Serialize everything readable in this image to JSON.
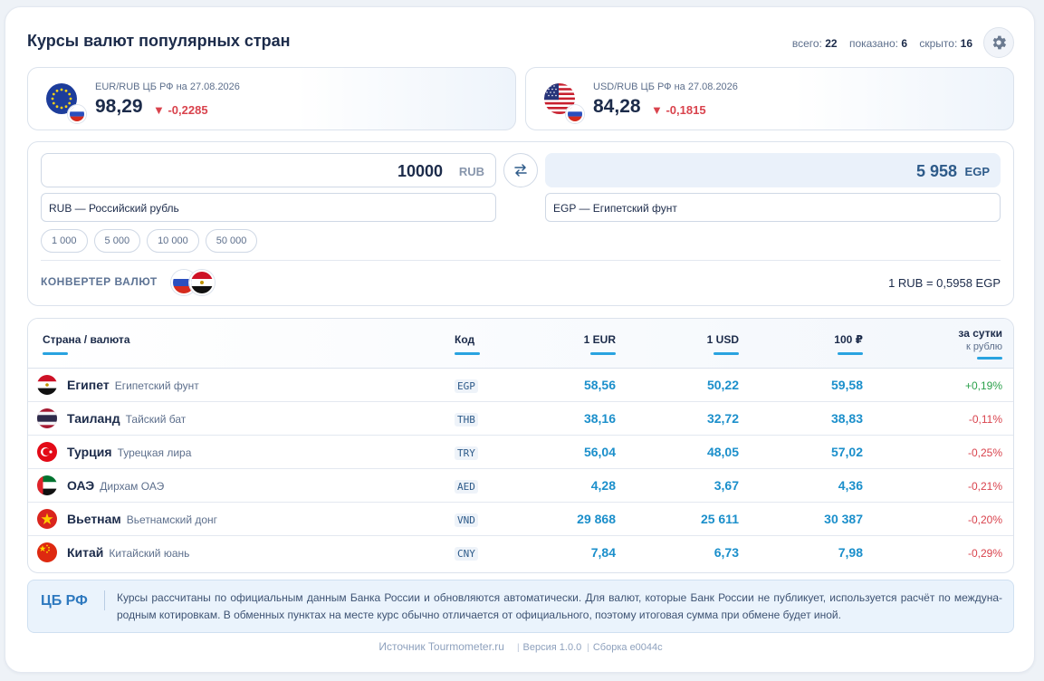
{
  "header": {
    "title": "Курсы валют популярных стран",
    "stats": [
      {
        "label": "всего:",
        "value": "22"
      },
      {
        "label": "показано:",
        "value": "6"
      },
      {
        "label": "скрыто:",
        "value": "16"
      }
    ],
    "settings_icon": "gear-icon"
  },
  "rates": {
    "eur": {
      "label": "EUR/RUB ЦБ РФ на 27.08.2026",
      "value": "98,29",
      "change": "▼ -0,2285"
    },
    "usd": {
      "label": "USD/RUB ЦБ РФ на 27.08.2026",
      "value": "84,28",
      "change": "▼ -0,1815"
    }
  },
  "converter": {
    "amount": "10000",
    "from_code": "RUB",
    "result": "5 958",
    "to_code": "EGP",
    "from_select": "RUB — Российский рубль",
    "to_select": "EGP — Египетский фунт",
    "quick_amounts": [
      "1 000",
      "5 000",
      "10 000",
      "50 000"
    ],
    "label": "КОНВЕРТЕР ВАЛЮТ",
    "rate_line": "1 RUB = 0,5958 EGP",
    "swap_icon": "swap-arrows-icon"
  },
  "table": {
    "headers": {
      "country": "Страна / валюта",
      "code": "Код",
      "eur": "1 EUR",
      "usd": "1 USD",
      "rub": "100 ₽",
      "day": "за сутки",
      "day_sub": "к рублю"
    },
    "rows": [
      {
        "country": "Египет",
        "currency": "Египетский фунт",
        "code": "EGP",
        "eur": "58,56",
        "usd": "50,22",
        "rub": "59,58",
        "change": "+0,19%",
        "dir": "up"
      },
      {
        "country": "Таиланд",
        "currency": "Тайский бат",
        "code": "THB",
        "eur": "38,16",
        "usd": "32,72",
        "rub": "38,83",
        "change": "-0,11%",
        "dir": "down"
      },
      {
        "country": "Турция",
        "currency": "Турецкая лира",
        "code": "TRY",
        "eur": "56,04",
        "usd": "48,05",
        "rub": "57,02",
        "change": "-0,25%",
        "dir": "down"
      },
      {
        "country": "ОАЭ",
        "currency": "Дирхам ОАЭ",
        "code": "AED",
        "eur": "4,28",
        "usd": "3,67",
        "rub": "4,36",
        "change": "-0,21%",
        "dir": "down"
      },
      {
        "country": "Вьетнам",
        "currency": "Вьетнамский донг",
        "code": "VND",
        "eur": "29 868",
        "usd": "25 611",
        "rub": "30 387",
        "change": "-0,20%",
        "dir": "down"
      },
      {
        "country": "Китай",
        "currency": "Китайский юань",
        "code": "CNY",
        "eur": "7,84",
        "usd": "6,73",
        "rub": "7,98",
        "change": "-0,29%",
        "dir": "down"
      }
    ]
  },
  "note": {
    "badge": "ЦБ РФ",
    "text": "Курсы рассчитаны по официальным данным Банка России и обновляются автоматически. Для валют, которые Банк России не публикует, используется расчёт по междуна-родным котировкам. В обменных пунктах на месте курс обычно отличается от официального, поэтому итоговая сумма при обмене будет иной."
  },
  "footer": {
    "source": "Источник Tourmometer.ru",
    "version": "Версия 1.0.0",
    "build": "Сборка e0044c"
  },
  "colors": {
    "accent": "#1b8fcb",
    "up": "#2ba14b",
    "down": "#d9434d",
    "title": "#1c2b4a"
  }
}
